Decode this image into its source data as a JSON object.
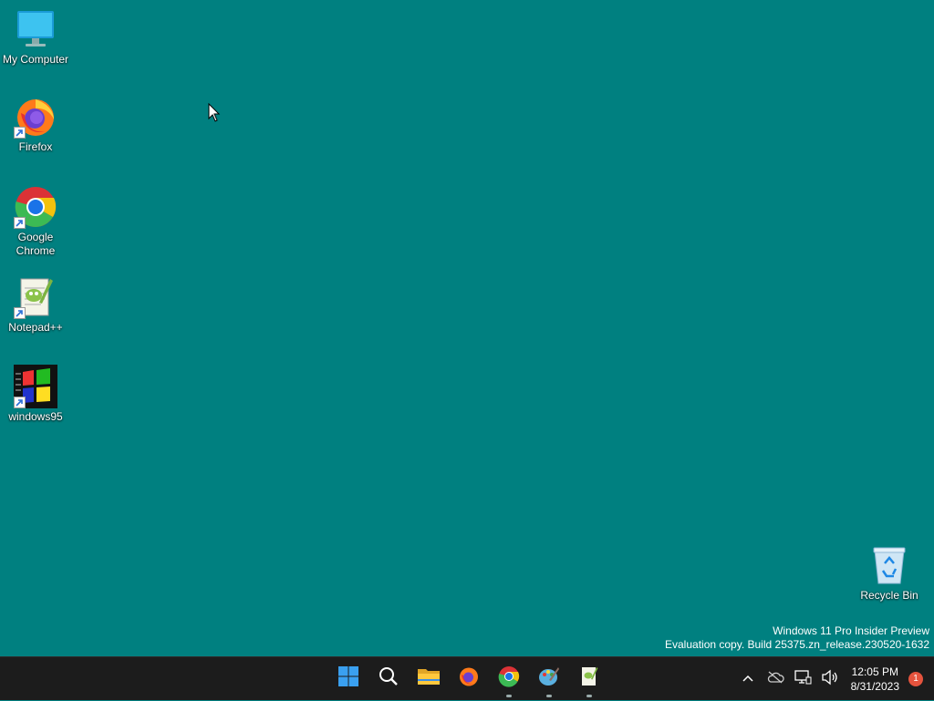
{
  "desktop": {
    "background": "#008080",
    "icons": [
      {
        "label": "My Computer",
        "icon": "monitor-icon"
      },
      {
        "label": "Firefox",
        "icon": "firefox-icon"
      },
      {
        "label": "Google\nChrome",
        "icon": "chrome-icon"
      },
      {
        "label": "Notepad++",
        "icon": "notepad-plus-plus-icon"
      },
      {
        "label": "windows95",
        "icon": "windows95-icon"
      },
      {
        "label": "Recycle Bin",
        "icon": "recycle-bin-icon"
      }
    ]
  },
  "watermark": {
    "line1": "Windows 11 Pro Insider Preview",
    "line2": "Evaluation copy. Build 25375.zn_release.230520-1632"
  },
  "taskbar": {
    "background": "#1c1c1c",
    "apps": [
      {
        "name": "start-button",
        "icon": "windows-start-icon"
      },
      {
        "name": "search-button",
        "icon": "search-icon"
      },
      {
        "name": "file-explorer-button",
        "icon": "folder-icon"
      },
      {
        "name": "firefox-button",
        "icon": "firefox-icon"
      },
      {
        "name": "chrome-button",
        "icon": "chrome-icon"
      },
      {
        "name": "paint-button",
        "icon": "paint-icon"
      },
      {
        "name": "notepad-plus-plus-button",
        "icon": "notepad-plus-plus-icon"
      }
    ],
    "clock": {
      "time": "12:05 PM",
      "date": "8/31/2023"
    },
    "notification_count": "1",
    "notification_color": "#e5533d"
  }
}
